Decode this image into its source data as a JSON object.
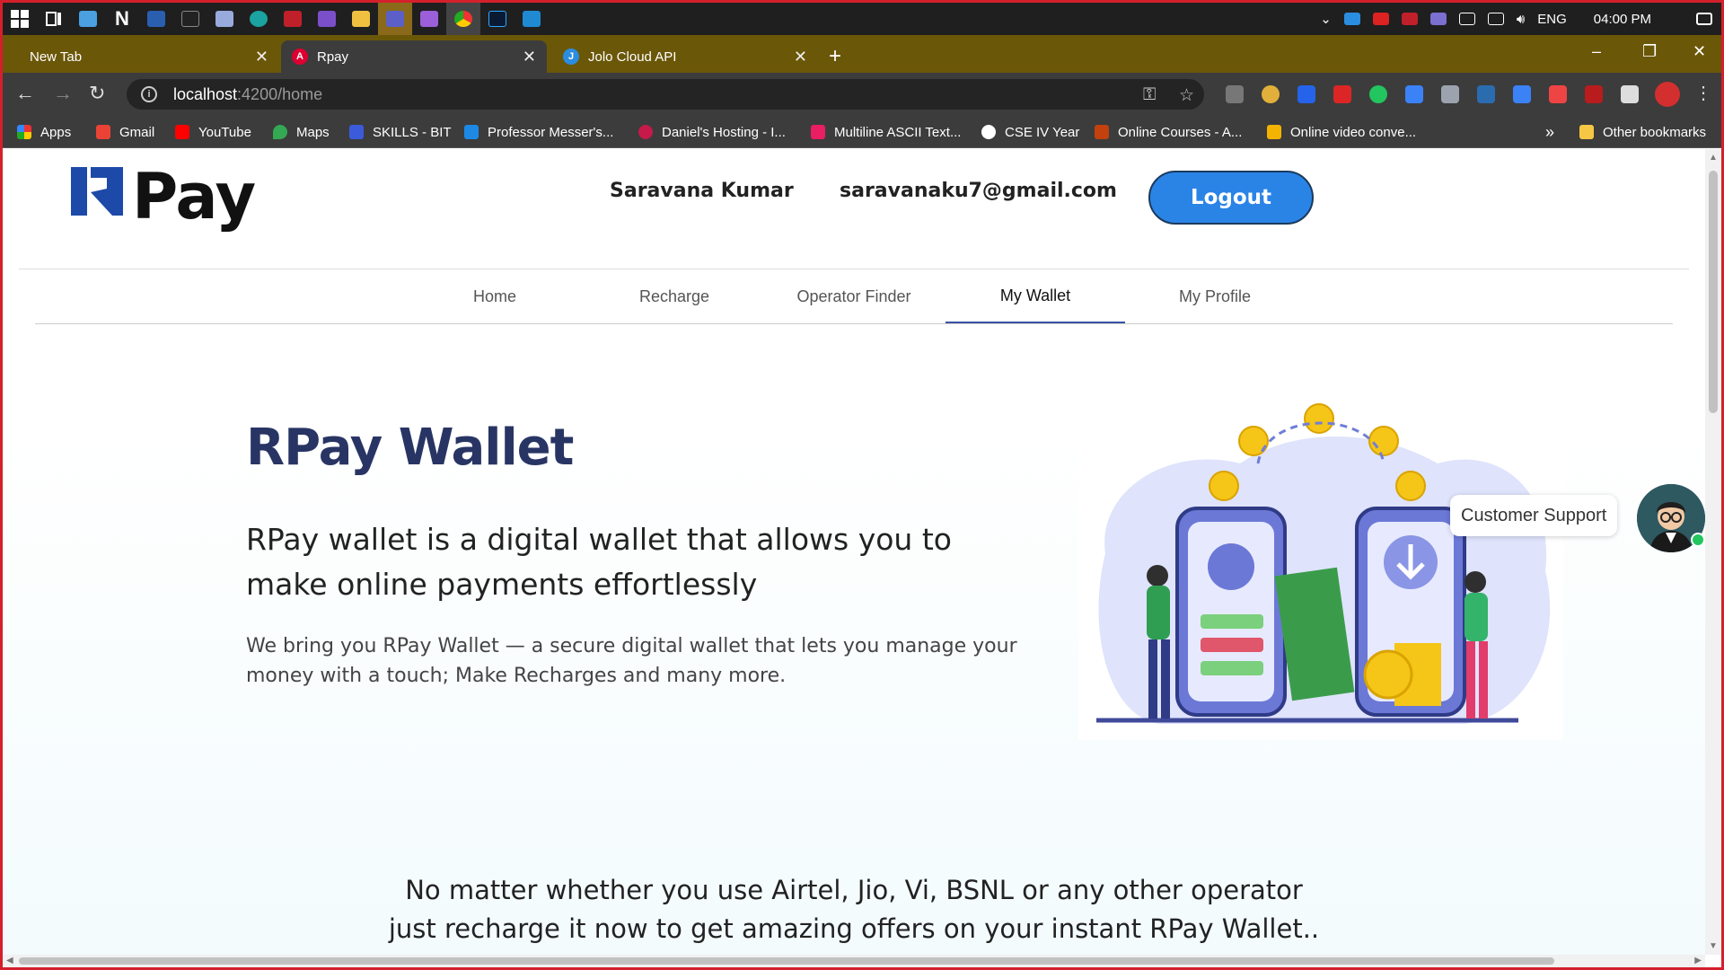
{
  "taskbar": {
    "apps": [
      "start",
      "task-view",
      "app1",
      "app2",
      "app3",
      "app4",
      "app5",
      "edge",
      "app7",
      "visual-studio",
      "file-explorer",
      "teams",
      "visual-studio-2",
      "chrome",
      "photoshop",
      "vscode"
    ],
    "tray": {
      "lang": "ENG",
      "time": "04:00 PM"
    }
  },
  "browser": {
    "tabs": [
      {
        "title": "New Tab"
      },
      {
        "title": "Rpay"
      },
      {
        "title": "Jolo Cloud API"
      }
    ],
    "url_host": "localhost",
    "url_path": ":4200/home",
    "bookmarks": [
      "Apps",
      "Gmail",
      "YouTube",
      "Maps",
      "SKILLS - BIT",
      "Professor Messer's...",
      "Daniel's Hosting - I...",
      "Multiline ASCII Text...",
      "CSE IV Year",
      "Online Courses - A...",
      "Online video conve..."
    ],
    "bookmarks_more": "»",
    "other_bookmarks": "Other bookmarks"
  },
  "header": {
    "logo_text": "Pay",
    "user_name": "Saravana Kumar",
    "user_email": "saravanaku7@gmail.com",
    "logout_label": "Logout"
  },
  "nav": {
    "tabs": [
      "Home",
      "Recharge",
      "Operator Finder",
      "My Wallet",
      "My Profile"
    ],
    "active": "My Wallet"
  },
  "hero": {
    "title": "RPay Wallet",
    "subtitle": "RPay wallet is a digital wallet that allows you to make online payments effortlessly",
    "description": "We bring you RPay Wallet — a secure digital wallet that lets you manage your money with a touch; Make Recharges and many more."
  },
  "bottom": {
    "line1": "No matter whether you use Airtel, Jio, Vi, BSNL or any other operator",
    "line2": "just recharge it now to get amazing offers on your instant RPay Wallet.."
  },
  "support": {
    "label": "Customer Support"
  },
  "colors": {
    "brand_navy": "#283564",
    "logout_blue": "#2a84e6",
    "tab_active_underline": "#3a53a4",
    "frame_red": "#d4202c"
  }
}
